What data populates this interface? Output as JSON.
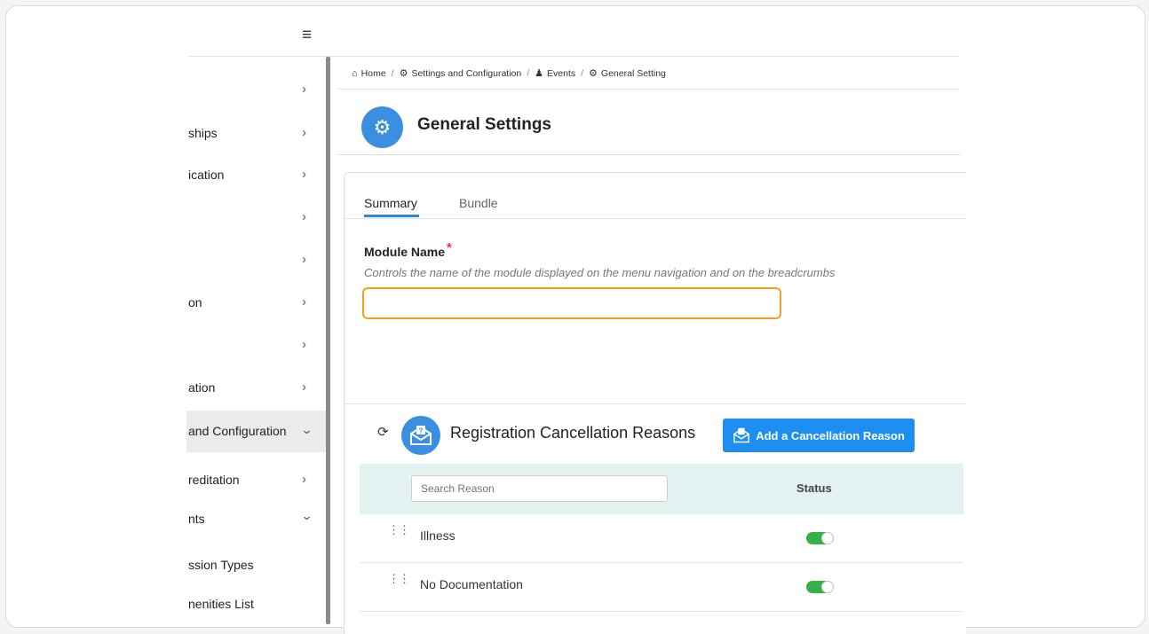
{
  "sidebar": {
    "items": [
      {
        "label": "",
        "expanded": false
      },
      {
        "label": "ships",
        "expanded": false
      },
      {
        "label": "ication",
        "expanded": false
      },
      {
        "label": "",
        "expanded": false
      },
      {
        "label": "",
        "expanded": false
      },
      {
        "label": "on",
        "expanded": false
      },
      {
        "label": "",
        "expanded": false
      },
      {
        "label": "ation",
        "expanded": false
      },
      {
        "label": "and Configuration",
        "expanded": true
      },
      {
        "label": "reditation",
        "expanded": false
      },
      {
        "label": "nts",
        "expanded": true
      },
      {
        "label": "ssion Types",
        "expanded": false
      },
      {
        "label": "nenities List",
        "expanded": false
      }
    ]
  },
  "breadcrumb": {
    "home": "Home",
    "settings": "Settings and Configuration",
    "events": "Events",
    "general": "General Setting"
  },
  "page": {
    "title": "General Settings"
  },
  "tabs": {
    "summary": "Summary",
    "bundle": "Bundle",
    "active": "Summary"
  },
  "module_name": {
    "label": "Module Name",
    "required_mark": "*",
    "hint": "Controls the name of the module displayed on the menu navigation and on the breadcrumbs",
    "value": ""
  },
  "reasons": {
    "title": "Registration Cancellation Reasons",
    "add_button": "Add a Cancellation Reason",
    "search_placeholder": "Search Reason",
    "status_header": "Status",
    "rows": [
      {
        "name": "Illness",
        "enabled": true
      },
      {
        "name": "No Documentation",
        "enabled": true
      }
    ]
  },
  "colors": {
    "accent": "#1e8ff0",
    "focus": "#f0a020",
    "toggle_on": "#35b04a"
  }
}
